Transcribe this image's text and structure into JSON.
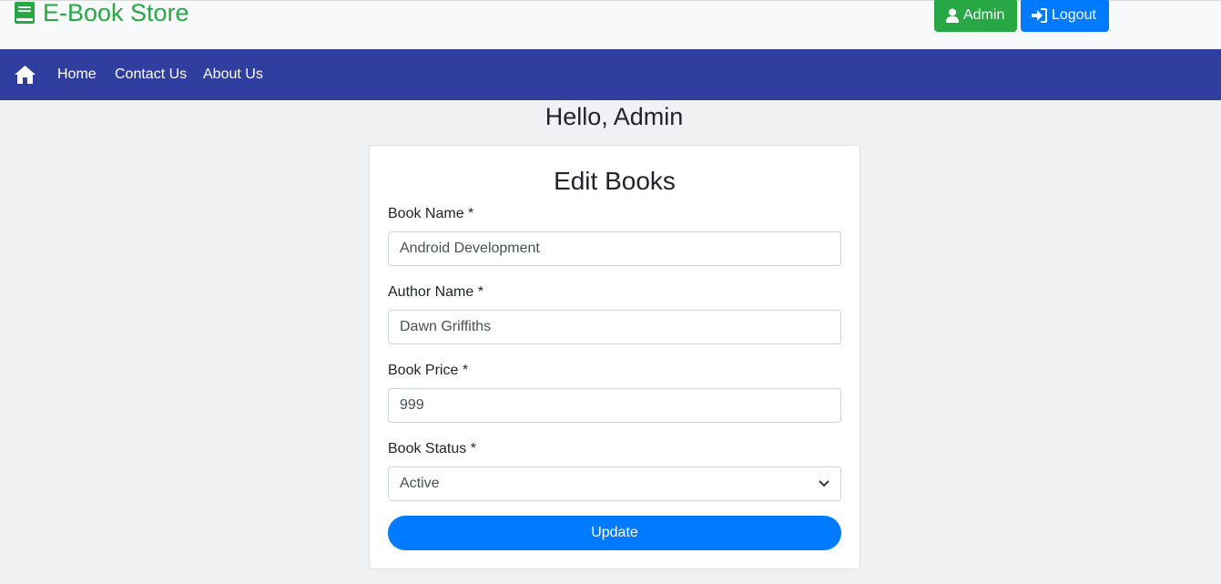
{
  "header": {
    "brand": "E-Book Store",
    "brand_icon": "book-icon",
    "admin_button": "Admin",
    "logout_button": "Logout",
    "colors": {
      "brand": "#28a745",
      "admin": "#28a745",
      "logout": "#007bff",
      "navbar": "#303f9f"
    }
  },
  "nav": {
    "home_icon": "home-icon",
    "links": [
      "Home",
      "Contact Us",
      "About Us"
    ]
  },
  "greeting": "Hello, Admin",
  "form": {
    "title": "Edit Books",
    "book_name_label": "Book Name *",
    "book_name_value": "Android Development",
    "author_name_label": "Author Name *",
    "author_name_value": "Dawn Griffiths",
    "book_price_label": "Book Price *",
    "book_price_value": "999",
    "book_status_label": "Book Status *",
    "book_status_value": "Active",
    "update_button": "Update"
  }
}
